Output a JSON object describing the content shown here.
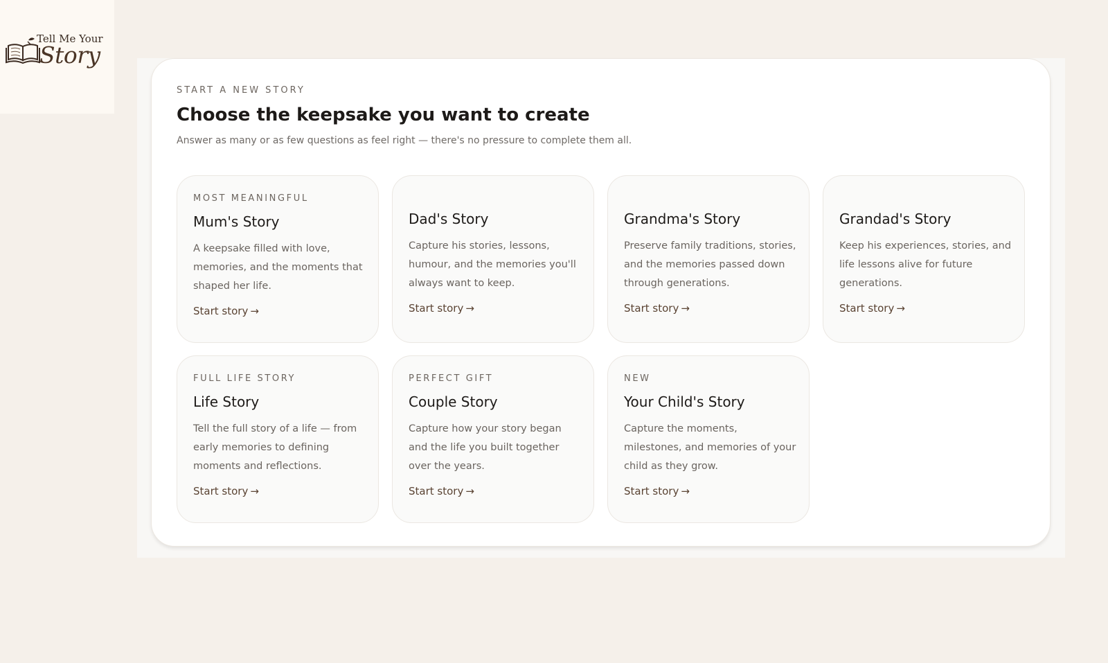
{
  "logo": {
    "line1": "Tell Me Your",
    "line2": "Story"
  },
  "header": {
    "eyebrow": "START A NEW STORY",
    "title": "Choose the keepsake you want to create",
    "subtitle": "Answer as many or as few questions as feel right — there's no pressure to complete them all."
  },
  "cards": [
    {
      "tag": "MOST MEANINGFUL",
      "title": "Mum's Story",
      "description": "A keepsake filled with love, memories, and the moments that shaped her life.",
      "link": "Start story",
      "arrow": "→"
    },
    {
      "tag": "",
      "title": "Dad's Story",
      "description": "Capture his stories, lessons, humour, and the memories you'll always want to keep.",
      "link": "Start story",
      "arrow": "→"
    },
    {
      "tag": "",
      "title": "Grandma's Story",
      "description": "Preserve family traditions, stories, and the memories passed down through generations.",
      "link": "Start story",
      "arrow": "→"
    },
    {
      "tag": "",
      "title": "Grandad's Story",
      "description": "Keep his experiences, stories, and life lessons alive for future generations.",
      "link": "Start story",
      "arrow": "→"
    },
    {
      "tag": "FULL LIFE STORY",
      "title": "Life Story",
      "description": "Tell the full story of a life — from early memories to defining moments and reflections.",
      "link": "Start story",
      "arrow": "→"
    },
    {
      "tag": "PERFECT GIFT",
      "title": "Couple Story",
      "description": "Capture how your story began and the life you built together over the years.",
      "link": "Start story",
      "arrow": "→"
    },
    {
      "tag": "NEW",
      "title": "Your Child's Story",
      "description": "Capture the moments, milestones, and memories of your child as they grow.",
      "link": "Start story",
      "arrow": "→"
    }
  ],
  "icons": {
    "logo": "open-book-icon"
  },
  "colors": {
    "background": "#f5f0ea",
    "panel": "#ffffff",
    "card": "#fafaf9",
    "link": "#5a4333"
  }
}
